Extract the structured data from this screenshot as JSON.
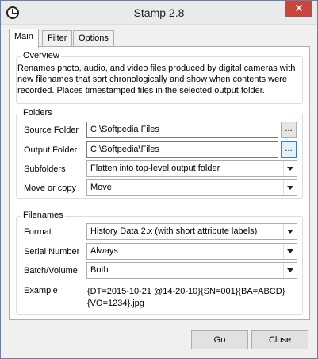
{
  "window": {
    "title": "Stamp 2.8",
    "close_glyph": "✕"
  },
  "tabs": [
    {
      "label": "Main",
      "active": true
    },
    {
      "label": "Filter",
      "active": false
    },
    {
      "label": "Options",
      "active": false
    }
  ],
  "overview": {
    "title": "Overview",
    "text": "Renames photo, audio, and video files produced by digital cameras with new filenames that sort chronologically and show when contents were recorded. Places timestamped files in the selected output folder."
  },
  "folders": {
    "title": "Folders",
    "source_label": "Source Folder",
    "source_value": "C:\\Softpedia Files",
    "source_browse": "...",
    "output_label": "Output Folder",
    "output_value": "C:\\Softpedia\\Files",
    "output_browse": "...",
    "subfolders_label": "Subfolders",
    "subfolders_value": "Flatten into top-level output folder",
    "move_label": "Move or copy",
    "move_value": "Move"
  },
  "filenames": {
    "title": "Filenames",
    "format_label": "Format",
    "format_value": "History Data 2.x (with short attribute labels)",
    "serial_label": "Serial Number",
    "serial_value": "Always",
    "batch_label": "Batch/Volume",
    "batch_value": "Both",
    "example_label": "Example",
    "example_line1": "{DT=2015-10-21 @14-20-10}{SN=001}{BA=ABCD}",
    "example_line2": "{VO=1234}.jpg"
  },
  "buttons": {
    "go": "Go",
    "close": "Close"
  }
}
